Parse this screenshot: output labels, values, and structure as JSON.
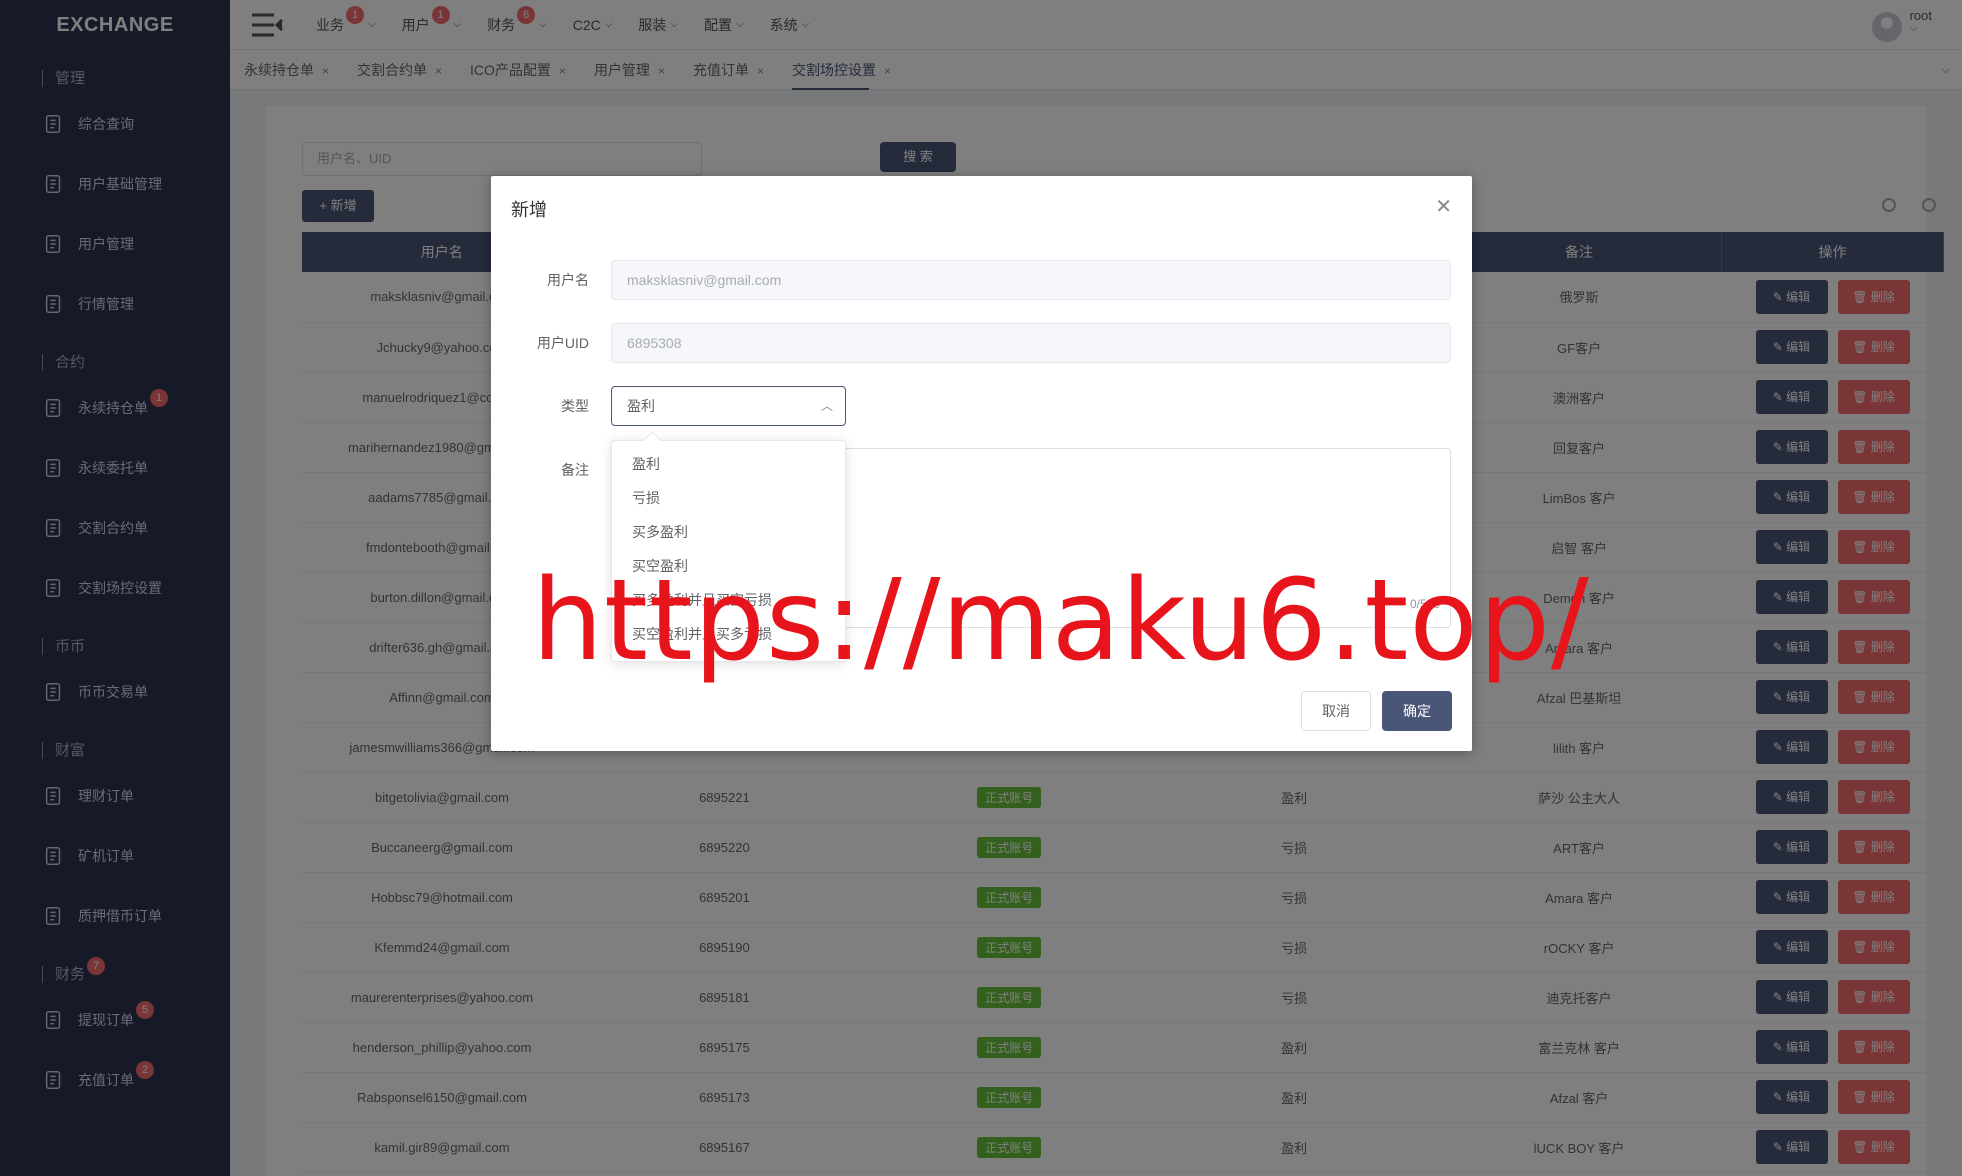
{
  "app": {
    "logo": "EXCHANGE"
  },
  "topbar": {
    "menu": [
      {
        "label": "业务",
        "badge": "1"
      },
      {
        "label": "用户",
        "badge": "1"
      },
      {
        "label": "财务",
        "badge": "6"
      },
      {
        "label": "C2C",
        "badge": ""
      },
      {
        "label": "服装",
        "badge": ""
      },
      {
        "label": "配置",
        "badge": ""
      },
      {
        "label": "系统",
        "badge": ""
      }
    ],
    "user": "root"
  },
  "sidebar": {
    "groups": [
      {
        "label": "管理",
        "items": [
          {
            "label": "综合查询",
            "badge": ""
          },
          {
            "label": "用户基础管理",
            "badge": ""
          },
          {
            "label": "用户管理",
            "badge": ""
          },
          {
            "label": "行情管理",
            "badge": ""
          }
        ]
      },
      {
        "label": "合约",
        "items": [
          {
            "label": "永续持仓单",
            "badge": "1"
          },
          {
            "label": "永续委托单",
            "badge": ""
          },
          {
            "label": "交割合约单",
            "badge": ""
          },
          {
            "label": "交割场控设置",
            "badge": ""
          }
        ]
      },
      {
        "label": "币币",
        "items": [
          {
            "label": "币币交易单",
            "badge": ""
          }
        ]
      },
      {
        "label": "财富",
        "items": [
          {
            "label": "理财订单",
            "badge": ""
          },
          {
            "label": "矿机订单",
            "badge": ""
          },
          {
            "label": "质押借币订单",
            "badge": ""
          }
        ]
      },
      {
        "label": "财务",
        "badge": "7",
        "items": [
          {
            "label": "提现订单",
            "badge": "5"
          },
          {
            "label": "充值订单",
            "badge": "2"
          }
        ]
      }
    ]
  },
  "tabs": [
    {
      "label": "永续持仓单",
      "active": false
    },
    {
      "label": "交割合约单",
      "active": false
    },
    {
      "label": "ICO产品配置",
      "active": false
    },
    {
      "label": "用户管理",
      "active": false
    },
    {
      "label": "充值订单",
      "active": false
    },
    {
      "label": "交割场控设置",
      "active": true
    }
  ],
  "toolbar": {
    "search_placeholder": "用户名、UID",
    "search_label": "搜 索",
    "add_label": "+ 新增"
  },
  "table": {
    "headers": [
      "用户名",
      "",
      "",
      "",
      "备注",
      "操作"
    ],
    "edit_label": "编辑",
    "delete_label": "删除",
    "tag_label": "正式账号",
    "rows": [
      {
        "user": "maksklasniv@gmail.com",
        "uid": "",
        "type": "",
        "note": "俄罗斯"
      },
      {
        "user": "Jchucky9@yahoo.com",
        "uid": "",
        "type": "",
        "note": "GF客户"
      },
      {
        "user": "manuelrodriquez1@cox.net",
        "uid": "",
        "type": "",
        "note": "澳洲客户"
      },
      {
        "user": "marihernandez1980@gmail.com",
        "uid": "",
        "type": "",
        "note": "回复客户"
      },
      {
        "user": "aadams7785@gmail.com",
        "uid": "",
        "type": "",
        "note": "LimBos 客户"
      },
      {
        "user": "fmdontebooth@gmail.com",
        "uid": "",
        "type": "",
        "note": "启智 客户"
      },
      {
        "user": "burton.dillon@gmail.com",
        "uid": "",
        "type": "",
        "note": "Demon 客户"
      },
      {
        "user": "drifter636.gh@gmail.com",
        "uid": "",
        "type": "",
        "note": "Amara 客户"
      },
      {
        "user": "Affinn@gmail.com",
        "uid": "",
        "type": "",
        "note": "Afzal 巴基斯坦"
      },
      {
        "user": "jamesmwilliams366@gmail.com",
        "uid": "",
        "type": "",
        "note": "lilith 客户"
      },
      {
        "user": "bitgetolivia@gmail.com",
        "uid": "6895221",
        "type": "盈利",
        "note": "萨沙 公主大人"
      },
      {
        "user": "Buccaneerg@gmail.com",
        "uid": "6895220",
        "type": "亏损",
        "note": "ART客户"
      },
      {
        "user": "Hobbsc79@hotmail.com",
        "uid": "6895201",
        "type": "亏损",
        "note": "Amara 客户"
      },
      {
        "user": "Kfemmd24@gmail.com",
        "uid": "6895190",
        "type": "亏损",
        "note": "rOCKY 客户"
      },
      {
        "user": "maurerenterprises@yahoo.com",
        "uid": "6895181",
        "type": "亏损",
        "note": "迪克托客户"
      },
      {
        "user": "henderson_phillip@yahoo.com",
        "uid": "6895175",
        "type": "盈利",
        "note": "富兰克林 客户"
      },
      {
        "user": "Rabsponsel6150@gmail.com",
        "uid": "6895173",
        "type": "盈利",
        "note": "Afzal 客户"
      },
      {
        "user": "kamil.gir89@gmail.com",
        "uid": "6895167",
        "type": "盈利",
        "note": "lUCK BOY 客户"
      }
    ]
  },
  "dialog": {
    "title": "新增",
    "username_label": "用户名",
    "username_value": "maksklasniv@gmail.com",
    "uid_label": "用户UID",
    "uid_value": "6895308",
    "type_label": "类型",
    "type_value": "盈利",
    "note_label": "备注",
    "note_count": "0/500",
    "cancel_label": "取消",
    "ok_label": "确定"
  },
  "dropdown": {
    "options": [
      "盈利",
      "亏损",
      "买多盈利",
      "买空盈利",
      "买多盈利并且买空亏损",
      "买空盈利并且买多亏损"
    ]
  },
  "watermark": "https://maku6.top/",
  "colors": {
    "sidebar": "#2b3350",
    "primary": "#4a5677",
    "danger": "#f56c6c",
    "success": "#67c23a",
    "watermark": "#e8141b"
  }
}
